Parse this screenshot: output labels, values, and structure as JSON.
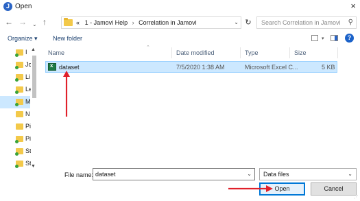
{
  "window": {
    "app_icon": "jamovi-logo-icon",
    "app_icon_glyph": "J",
    "title": "Open",
    "close_glyph": "×"
  },
  "navigation": {
    "back_glyph": "←",
    "forward_glyph": "→",
    "recent_glyph": "⌄",
    "up_glyph": "↑",
    "overflow_glyph": "«",
    "breadcrumbs": [
      "1 - Jamovi Help",
      "Correlation in Jamovi"
    ],
    "breadcrumb_separator": "›",
    "dropdown_glyph": "⌄",
    "refresh_glyph": "↻",
    "search_placeholder": "Search Correlation in Jamovi",
    "search_icon_glyph": "⚲"
  },
  "toolbar": {
    "organize_label": "Organize ▾",
    "new_folder_label": "New folder",
    "view_caret": "▾",
    "help_glyph": "?"
  },
  "sidebar": {
    "items": [
      {
        "label": "I",
        "icon": "green"
      },
      {
        "label": "Jc",
        "icon": "green"
      },
      {
        "label": "Li",
        "icon": "green"
      },
      {
        "label": "Le",
        "icon": "green"
      },
      {
        "label": "M",
        "icon": "green",
        "selected": true
      },
      {
        "label": "N",
        "icon": "plain"
      },
      {
        "label": "Pi",
        "icon": "plain"
      },
      {
        "label": "Pi",
        "icon": "green"
      },
      {
        "label": "St",
        "icon": "green"
      },
      {
        "label": "St",
        "icon": "green"
      }
    ],
    "scroll_up_glyph": "▲",
    "scroll_down_glyph": "▼"
  },
  "file_list": {
    "columns": [
      "Name",
      "Date modified",
      "Type",
      "Size"
    ],
    "sort_glyph": "⌃",
    "rows": [
      {
        "name": "dataset",
        "date_modified": "7/5/2020 1:38 AM",
        "type": "Microsoft Excel C...",
        "size": "5 KB",
        "selected": true
      }
    ]
  },
  "footer": {
    "file_name_label": "File name:",
    "file_name_value": "dataset",
    "file_name_dropdown": "⌄",
    "file_type_value": "Data files",
    "file_type_dropdown": "⌄",
    "open_label": "Open",
    "cancel_label": "Cancel",
    "resize_grip": "⋰"
  },
  "annotation_colors": {
    "arrow": "#e0202a"
  }
}
